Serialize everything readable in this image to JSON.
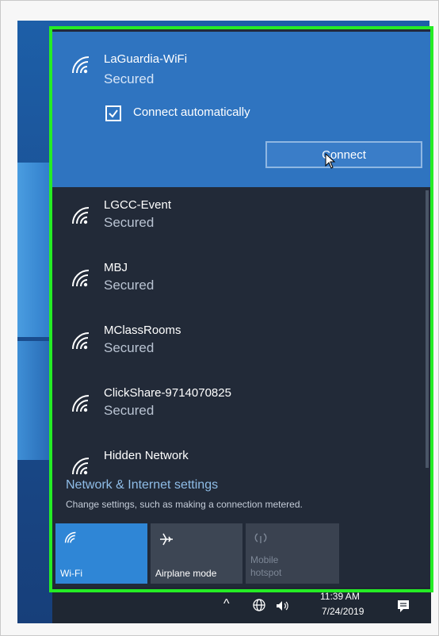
{
  "selected_network": {
    "name": "LaGuardia-WiFi",
    "status": "Secured",
    "connect_auto_label": "Connect automatically",
    "connect_auto_checked": true,
    "connect_button": "Connect"
  },
  "networks": [
    {
      "name": "LGCC-Event",
      "status": "Secured"
    },
    {
      "name": "MBJ",
      "status": "Secured"
    },
    {
      "name": "MClassRooms",
      "status": "Secured"
    },
    {
      "name": "ClickShare-9714070825",
      "status": "Secured"
    },
    {
      "name": "Hidden Network",
      "status": ""
    }
  ],
  "settings": {
    "link": "Network & Internet settings",
    "description": "Change settings, such as making a connection metered."
  },
  "quick_actions": [
    {
      "label": "Wi-Fi",
      "icon": "wifi-icon",
      "active": true
    },
    {
      "label": "Airplane mode",
      "icon": "airplane-icon",
      "active": false
    },
    {
      "label": "Mobile hotspot",
      "icon": "hotspot-icon",
      "active": false
    }
  ],
  "taskbar": {
    "time": "11:39 AM",
    "date": "7/24/2019"
  },
  "colors": {
    "highlight": "#25ec25",
    "selected_bg": "#2f74c0",
    "flyout_bg": "#222a38",
    "link": "#8fbde8"
  }
}
